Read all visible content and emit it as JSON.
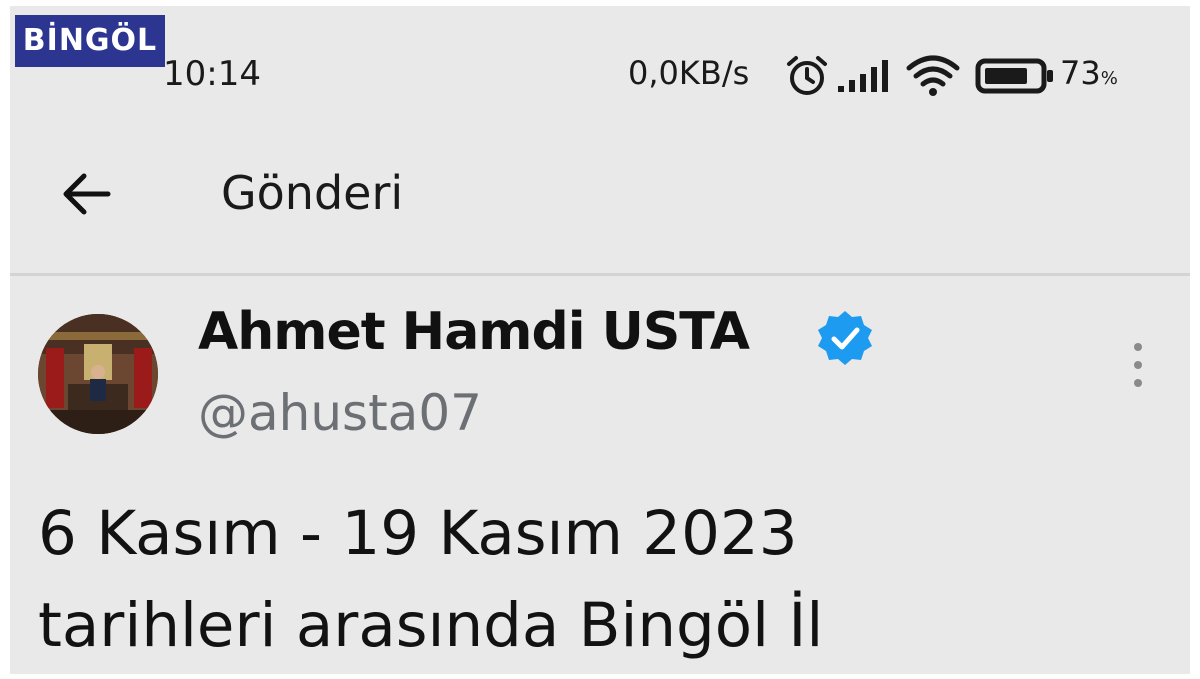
{
  "watermark": {
    "text": "BİNGÖL",
    "color": "#2c3690"
  },
  "status_bar": {
    "time": "10:14",
    "net_speed": "0,0KB/s",
    "battery_percent": "73",
    "battery_unit": "%",
    "icons": [
      "alarm-icon",
      "signal-icon",
      "wifi-icon",
      "battery-icon"
    ]
  },
  "app_bar": {
    "title": "Gönderi",
    "back_icon": "arrow-left-icon"
  },
  "post": {
    "author_name": "Ahmet Hamdi USTA",
    "author_handle": "@ahusta07",
    "verified_color": "#1d9bf0",
    "text_lines": [
      "6 Kasım - 19 Kasım 2023",
      "tarihleri arasında Bingöl İl"
    ]
  }
}
